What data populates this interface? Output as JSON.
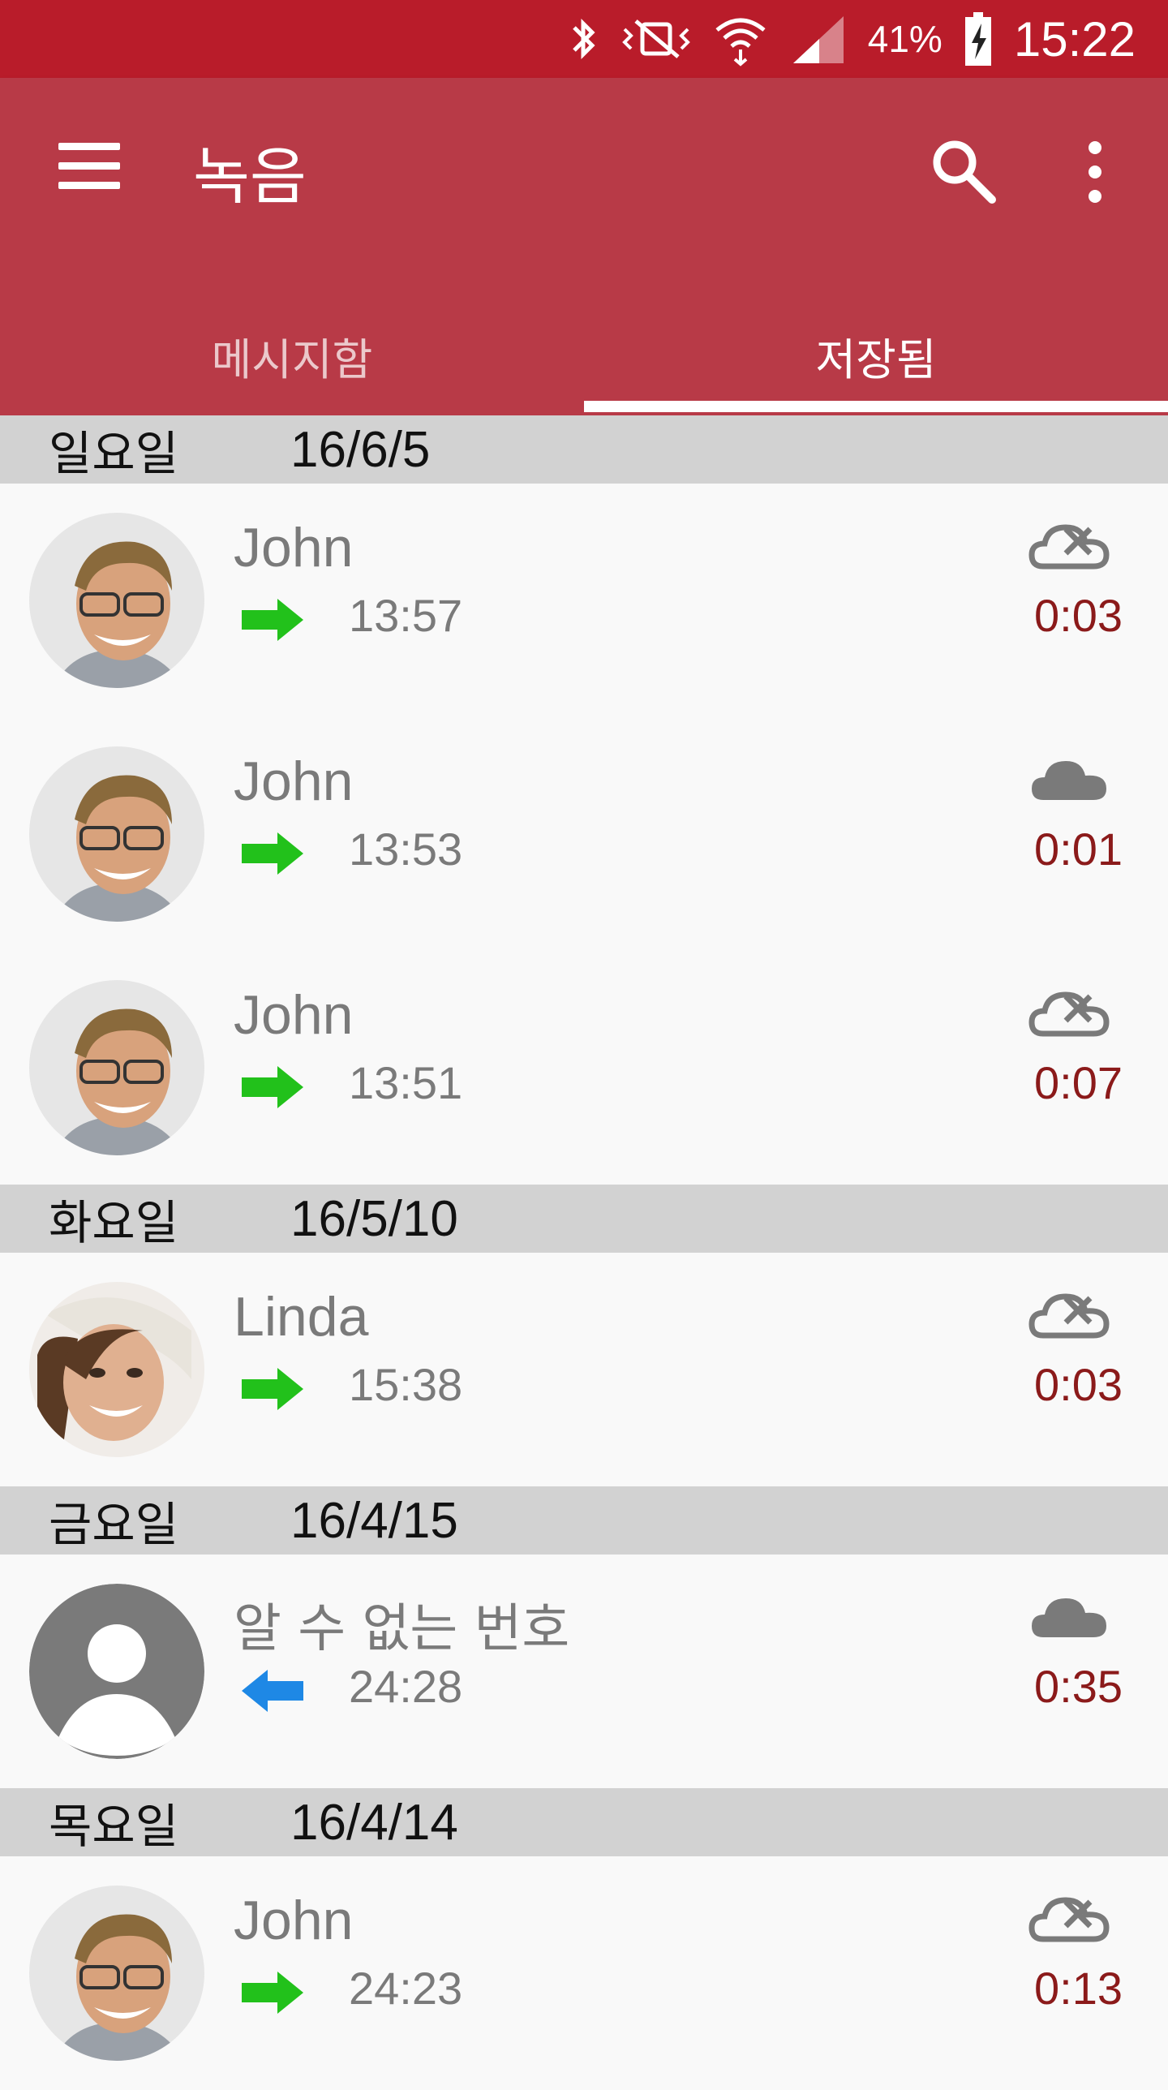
{
  "status_bar": {
    "battery": "41%",
    "time": "15:22"
  },
  "app_bar": {
    "title": "녹음"
  },
  "tabs": [
    {
      "label": "메시지함"
    },
    {
      "label": "저장됨"
    }
  ],
  "sections": [
    {
      "day": "일요일",
      "date": "16/6/5"
    },
    {
      "day": "화요일",
      "date": "16/5/10"
    },
    {
      "day": "금요일",
      "date": "16/4/15"
    },
    {
      "day": "목요일",
      "date": "16/4/14"
    }
  ],
  "calls": [
    {
      "name": "John",
      "time": "13:57",
      "duration": "0:03",
      "direction": "outgoing",
      "cloud": "not-uploaded"
    },
    {
      "name": "John",
      "time": "13:53",
      "duration": "0:01",
      "direction": "outgoing",
      "cloud": "uploaded"
    },
    {
      "name": "John",
      "time": "13:51",
      "duration": "0:07",
      "direction": "outgoing",
      "cloud": "not-uploaded"
    },
    {
      "name": "Linda",
      "time": "15:38",
      "duration": "0:03",
      "direction": "outgoing",
      "cloud": "not-uploaded"
    },
    {
      "name": "알 수 없는 번호",
      "time": "24:28",
      "duration": "0:35",
      "direction": "incoming",
      "cloud": "uploaded"
    },
    {
      "name": "John",
      "time": "24:23",
      "duration": "0:13",
      "direction": "outgoing",
      "cloud": "not-uploaded"
    }
  ],
  "colors": {
    "status_bar": "#b91c2a",
    "app_bar": "#b83a47",
    "outgoing_arrow": "#22c11b",
    "incoming_arrow": "#1e88e5",
    "duration": "#8b1a1a"
  }
}
